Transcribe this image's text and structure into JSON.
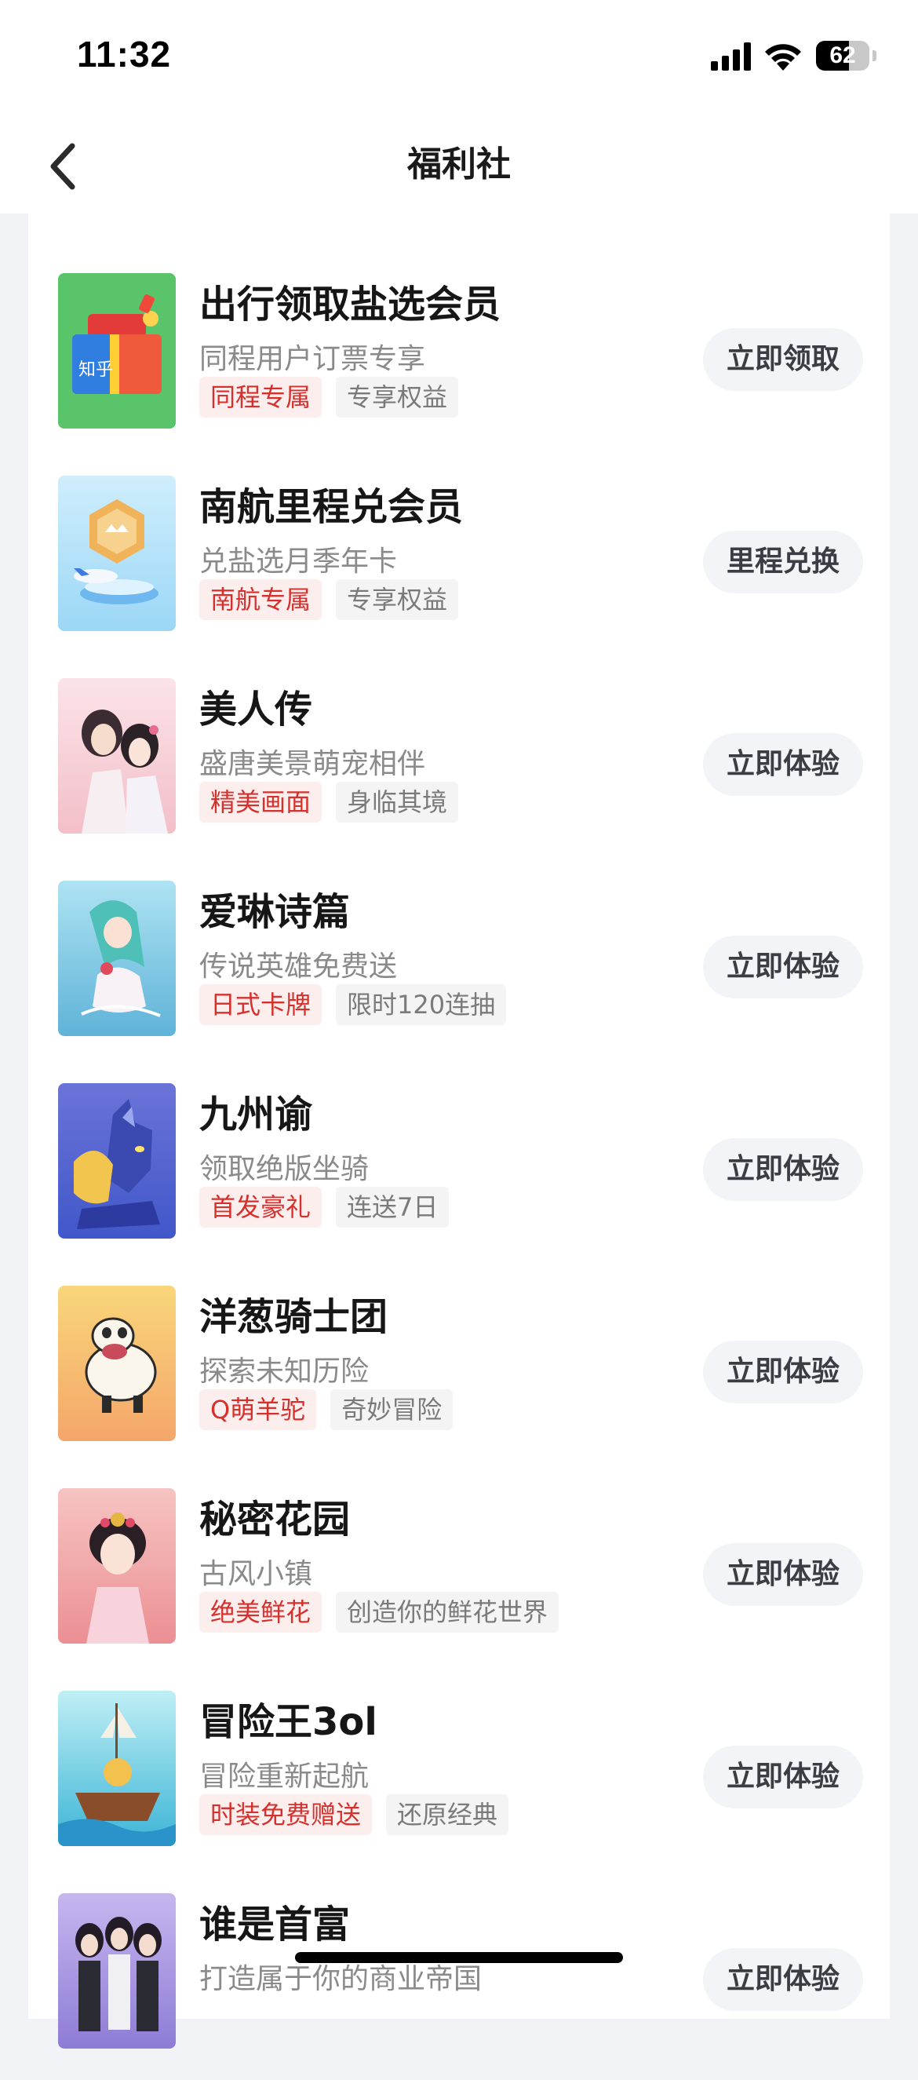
{
  "status_bar": {
    "time": "11:32",
    "battery_level": "62",
    "battery_fraction": 0.62
  },
  "nav": {
    "title": "福利社",
    "back_icon": "chevron-left-icon"
  },
  "colors": {
    "accent": "#d5302c",
    "tag_primary_bg": "#fdeeee",
    "button_bg": "#f3f4f7"
  },
  "items": [
    {
      "title": "出行领取盐选会员",
      "subtitle": "同程用户订票专享",
      "tag1": "同程专属",
      "tag2": "专享权益",
      "button": "立即领取",
      "thumb": "gift-box-thumbnail"
    },
    {
      "title": "南航里程兑会员",
      "subtitle": "兑盐选月季年卡",
      "tag1": "南航专属",
      "tag2": "专享权益",
      "button": "里程兑换",
      "thumb": "airplane-badge-thumbnail"
    },
    {
      "title": "美人传",
      "subtitle": "盛唐美景萌宠相伴",
      "tag1": "精美画面",
      "tag2": "身临其境",
      "button": "立即体验",
      "thumb": "game-art-thumbnail"
    },
    {
      "title": "爱琳诗篇",
      "subtitle": "传说英雄免费送",
      "tag1": "日式卡牌",
      "tag2": "限时120连抽",
      "button": "立即体验",
      "thumb": "game-art-thumbnail"
    },
    {
      "title": "九州谕",
      "subtitle": "领取绝版坐骑",
      "tag1": "首发豪礼",
      "tag2": "连送7日",
      "button": "立即体验",
      "thumb": "game-art-thumbnail"
    },
    {
      "title": "洋葱骑士团",
      "subtitle": "探索未知历险",
      "tag1": "Q萌羊驼",
      "tag2": "奇妙冒险",
      "button": "立即体验",
      "thumb": "game-art-thumbnail"
    },
    {
      "title": "秘密花园",
      "subtitle": "古风小镇",
      "tag1": "绝美鲜花",
      "tag2": "创造你的鲜花世界",
      "button": "立即体验",
      "thumb": "game-art-thumbnail"
    },
    {
      "title": "冒险王3ol",
      "subtitle": "冒险重新起航",
      "tag1": "时装免费赠送",
      "tag2": "还原经典",
      "button": "立即体验",
      "thumb": "game-art-thumbnail"
    },
    {
      "title": "谁是首富",
      "subtitle": "打造属于你的商业帝国",
      "tag1": "",
      "tag2": "",
      "button": "立即体验",
      "thumb": "game-art-thumbnail"
    }
  ]
}
